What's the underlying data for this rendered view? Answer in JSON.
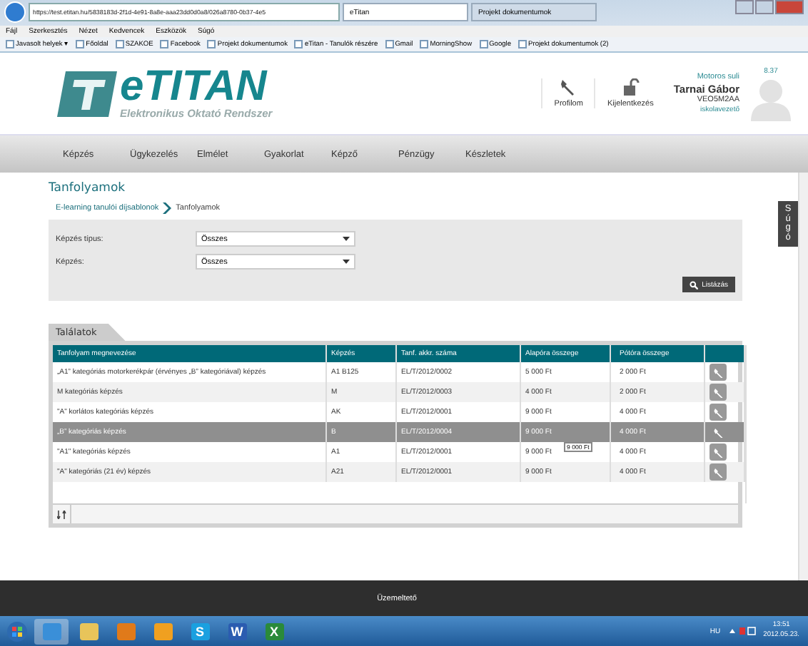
{
  "browser": {
    "address": "https://test.etitan.hu/5838183d-2f1d-4e91-8a8e-aaa23dd0d0a8/026a8780-0b37-4e5",
    "tabs": [
      {
        "title": "eTitan",
        "selected": true
      },
      {
        "title": "Projekt dokumentumok",
        "selected": false
      }
    ],
    "menu": [
      "Fájl",
      "Szerkesztés",
      "Nézet",
      "Kedvencek",
      "Eszközök",
      "Súgó"
    ],
    "favorites": [
      "Javasolt helyek ▾",
      "Főoldal",
      "SZAKOE",
      "Facebook",
      "Projekt dokumentumok",
      "eTitan - Tanulók részére",
      "Gmail",
      "MorningShow",
      "Google",
      "Projekt dokumentumok (2)"
    ]
  },
  "header": {
    "logo": "eTITAN",
    "logo_subtitle": "Elektronikus Oktató Rendszer",
    "actions": [
      {
        "label": "Profilom",
        "kind": "wrench"
      },
      {
        "label": "Kijelentkezés",
        "kind": "lock"
      }
    ],
    "user": {
      "school": "Motoros suli",
      "name": "Tarnai Gábor",
      "code": "VEO5M2AA",
      "role": "iskolavezető",
      "version": "8.37"
    }
  },
  "nav": [
    "Képzés",
    "Ügykezelés",
    "Elmélet",
    "Gyakorlat",
    "Képző",
    "Pénzügy",
    "Készletek"
  ],
  "help_tab": "Súgó",
  "page": {
    "title": "Tanfolyamok",
    "breadcrumb": [
      "E-learning tanulói díjsablonok",
      "Tanfolyamok"
    ],
    "filters": [
      {
        "label": "Képzés típus:",
        "value": "Összes"
      },
      {
        "label": "Képzés:",
        "value": "Összes"
      }
    ],
    "list_button": "Listázás"
  },
  "results": {
    "tab": "Találatok",
    "columns": [
      "Tanfolyam megnevezése",
      "Képzés",
      "Tanf. akkr. száma",
      "Alapóra összege",
      "Pótóra összege"
    ],
    "rows": [
      {
        "cells": [
          "„A1” kategóriás motorkerékpár (érvényes „B” kategóriával) képzés",
          "A1 B125",
          "EL/T/2012/0002",
          "5 000 Ft",
          "2 000 Ft"
        ],
        "selected": false
      },
      {
        "cells": [
          "M kategóriás képzés",
          "M",
          "EL/T/2012/0003",
          "4 000 Ft",
          "2 000 Ft"
        ],
        "selected": false
      },
      {
        "cells": [
          "\"A\" korlátos kategóriás képzés",
          "AK",
          "EL/T/2012/0001",
          "9 000 Ft",
          "4 000 Ft"
        ],
        "selected": false
      },
      {
        "cells": [
          "„B” kategóriás képzés",
          "B",
          "EL/T/2012/0004",
          "9 000 Ft",
          "4 000 Ft"
        ],
        "selected": true
      },
      {
        "cells": [
          "\"A1\" kategóriás képzés",
          "A1",
          "EL/T/2012/0001",
          "9 000 Ft",
          "4 000 Ft"
        ],
        "selected": false
      },
      {
        "cells": [
          "\"A\" kategóriás (21 év) képzés",
          "A21",
          "EL/T/2012/0001",
          "9 000 Ft",
          "4 000 Ft"
        ],
        "selected": false
      }
    ],
    "tooltip": "9 000 Ft"
  },
  "footer": "Üzemeltető",
  "taskbar": {
    "apps": [
      {
        "kind": "ie",
        "selected": true
      },
      {
        "kind": "folder",
        "selected": false
      },
      {
        "kind": "media",
        "selected": false
      },
      {
        "kind": "outlook",
        "selected": false
      },
      {
        "kind": "skype",
        "glyph": "S",
        "selected": false
      },
      {
        "kind": "word",
        "glyph": "W",
        "selected": false
      },
      {
        "kind": "excel",
        "glyph": "X",
        "selected": false
      }
    ],
    "language": "HU",
    "time": "13:51",
    "date": "2012.05.23."
  }
}
